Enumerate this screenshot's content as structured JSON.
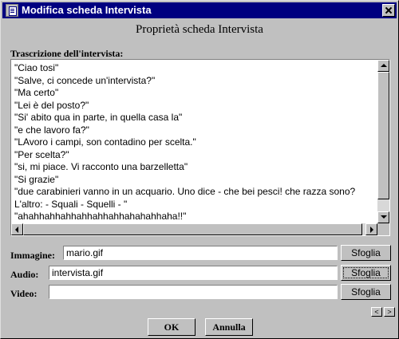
{
  "window": {
    "title": "Modifica scheda Intervista",
    "heading": "Proprietà scheda Intervista"
  },
  "transcript": {
    "label": "Trascrizione dell'intervista:",
    "lines": [
      "\"Ciao tosi\"",
      "\"Salve, ci concede un'intervista?\"",
      "\"Ma certo\"",
      "\"Lei è del posto?\"",
      "\"Si' abito qua in parte, in quella casa la\"",
      "\"e che lavoro fa?\"",
      "\"LAvoro i campi, son contadino per scelta.\"",
      "\"Per scelta?\"",
      "\"si, mi piace. Vi racconto una barzelletta\"",
      "\"Si grazie\"",
      "\"due carabinieri vanno in un acquario. Uno dice - che bei pesci! che razza sono?",
      "L'altro: - Squali - Squelli - \"",
      "\"ahahhahhahhahhahhahhahahahhaha!!\""
    ]
  },
  "fields": {
    "immagine": {
      "label": "Immagine:",
      "value": "mario.gif",
      "button": "Sfoglia"
    },
    "audio": {
      "label": "Audio:",
      "value": "intervista.gif",
      "button": "Sfoglia"
    },
    "video": {
      "label": "Video:",
      "value": "",
      "button": "Sfoglia"
    }
  },
  "nav": {
    "prev": "<",
    "next": ">"
  },
  "actions": {
    "ok": "OK",
    "cancel": "Annulla"
  },
  "icons": {
    "app": "document-icon",
    "close": "close-icon",
    "scroll_up": "arrow-up-icon",
    "scroll_down": "arrow-down-icon",
    "scroll_left": "arrow-left-icon",
    "scroll_right": "arrow-right-icon"
  },
  "colors": {
    "titlebar": "#000080",
    "face": "#c0c0c0",
    "field": "#ffffff"
  }
}
